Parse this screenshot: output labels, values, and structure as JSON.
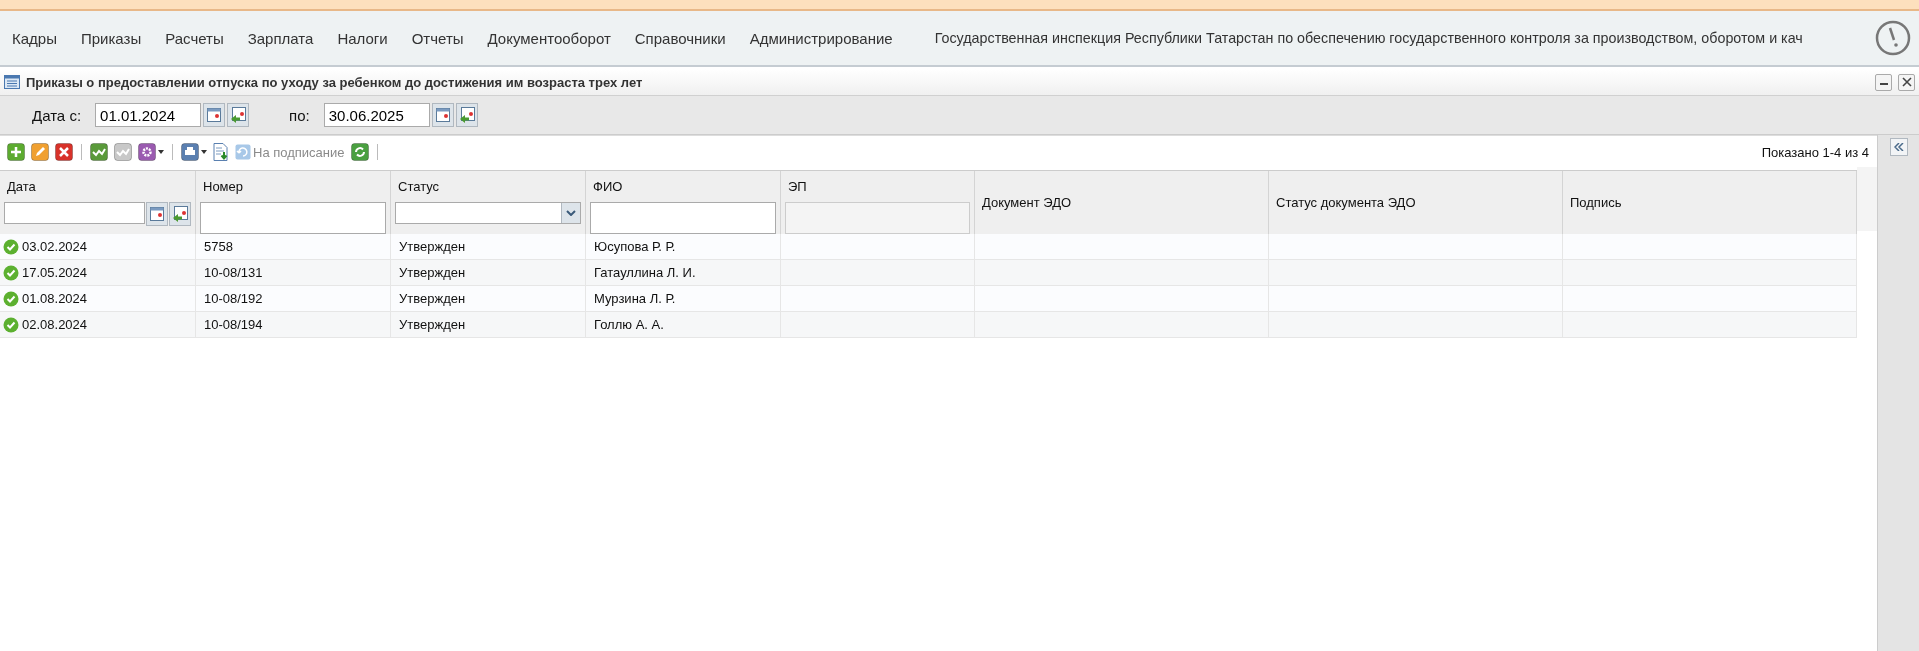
{
  "nav": {
    "items": [
      "Кадры",
      "Приказы",
      "Расчеты",
      "Зарплата",
      "Налоги",
      "Отчеты",
      "Документооборот",
      "Справочники",
      "Администрирование"
    ],
    "organization": "Государственная инспекция Республики Татарстан по обеспечению государственного контроля за производством, оборотом и кач"
  },
  "window": {
    "title": "Приказы о предоставлении отпуска по уходу за ребенком до достижения им возраста трех лет"
  },
  "date_filter": {
    "from_label": "Дата с:",
    "from_value": "01.01.2024",
    "to_label": "по:",
    "to_value": "30.06.2025"
  },
  "toolbar": {
    "buttons": [
      {
        "kind": "add",
        "disabled": false
      },
      {
        "kind": "edit",
        "disabled": false
      },
      {
        "kind": "delete",
        "disabled": false
      },
      {
        "kind": "separator"
      },
      {
        "kind": "approve",
        "disabled": false
      },
      {
        "kind": "approve",
        "disabled": true
      },
      {
        "kind": "gear-menu",
        "disabled": false
      },
      {
        "kind": "separator"
      },
      {
        "kind": "print-menu",
        "disabled": false
      },
      {
        "kind": "export",
        "disabled": false
      },
      {
        "kind": "sign",
        "disabled": true,
        "label": "На подписание"
      },
      {
        "kind": "refresh",
        "disabled": false
      },
      {
        "kind": "separator"
      }
    ],
    "paging": "Показано 1-4 из 4"
  },
  "table": {
    "columns": [
      {
        "title": "Дата",
        "kind": "date"
      },
      {
        "title": "Номер",
        "kind": "text"
      },
      {
        "title": "Статус",
        "kind": "select"
      },
      {
        "title": "ФИО",
        "kind": "text"
      },
      {
        "title": "ЭП",
        "kind": "disabled"
      },
      {
        "title": "Документ ЭДО",
        "kind": "plain"
      },
      {
        "title": "Статус документа ЭДО",
        "kind": "plain"
      },
      {
        "title": "Подпись",
        "kind": "plain"
      }
    ],
    "rows": [
      [
        "03.02.2024",
        "5758",
        "Утвержден",
        "Юсупова Р. Р.",
        "",
        "",
        "",
        ""
      ],
      [
        "17.05.2024",
        "10-08/131",
        "Утвержден",
        "Гатауллина Л. И.",
        "",
        "",
        "",
        ""
      ],
      [
        "01.08.2024",
        "10-08/192",
        "Утвержден",
        "Мурзина Л. Р.",
        "",
        "",
        "",
        ""
      ],
      [
        "02.08.2024",
        "10-08/194",
        "Утвержден",
        "Голлю А. А.",
        "",
        "",
        "",
        ""
      ]
    ]
  }
}
